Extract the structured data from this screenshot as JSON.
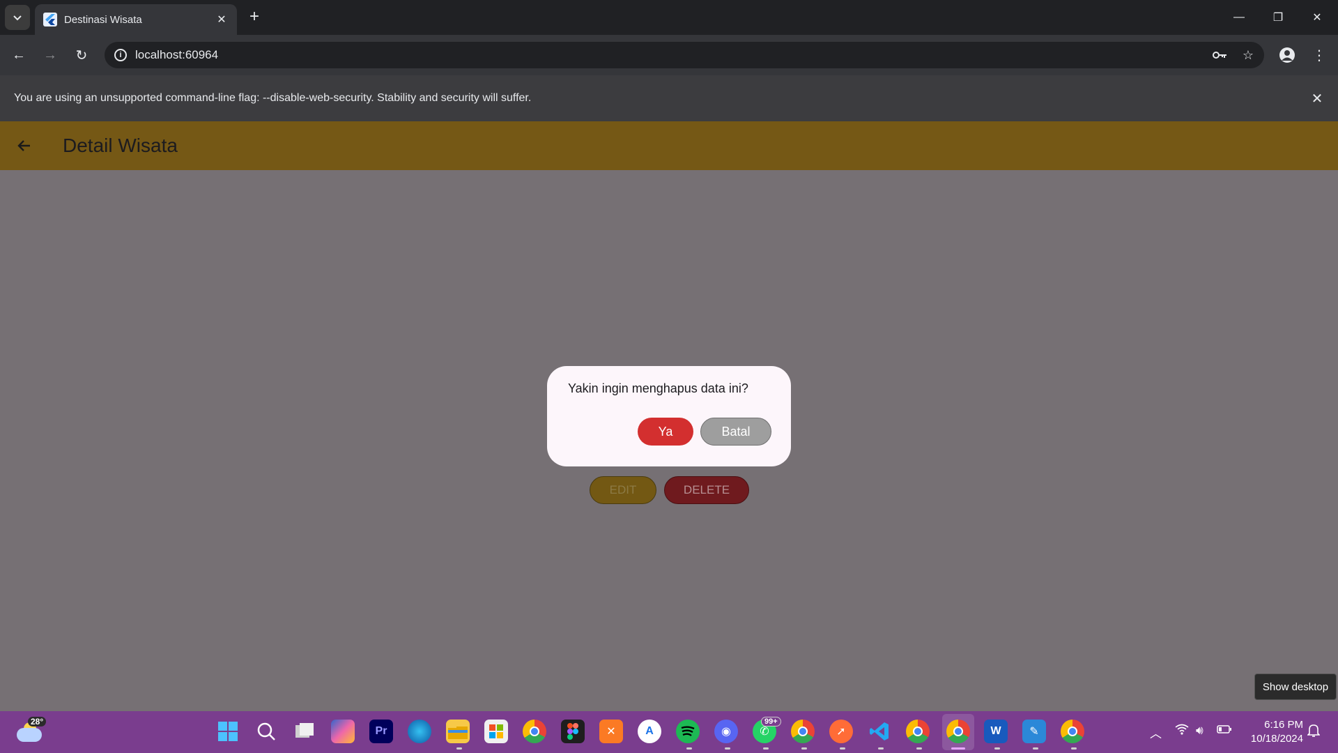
{
  "browser": {
    "tab_title": "Destinasi Wisata",
    "url": "localhost:60964",
    "infobar_message": "You are using an unsupported command-line flag: --disable-web-security. Stability and security will suffer."
  },
  "app": {
    "title": "Detail Wisata",
    "edit_label": "EDIT",
    "delete_label": "DELETE",
    "appbar_color": "#755815"
  },
  "dialog": {
    "message": "Yakin ingin menghapus data ini?",
    "confirm_label": "Ya",
    "cancel_label": "Batal",
    "confirm_color": "#d32f2f",
    "cancel_color": "#9e9e9e"
  },
  "tooltip": "Show desktop",
  "taskbar": {
    "weather_temp": "28°",
    "whatsapp_badge": "99+",
    "time": "6:16 PM",
    "date": "10/18/2024",
    "apps": [
      "start",
      "search",
      "task-view",
      "copilot",
      "premiere-pro",
      "edge",
      "file-explorer",
      "microsoft-store",
      "chrome",
      "figma",
      "xampp",
      "android-studio",
      "spotify",
      "discord",
      "whatsapp",
      "chrome-profile",
      "postman",
      "vscode",
      "chrome-profile",
      "chrome",
      "word",
      "pen-tool",
      "chrome"
    ]
  }
}
